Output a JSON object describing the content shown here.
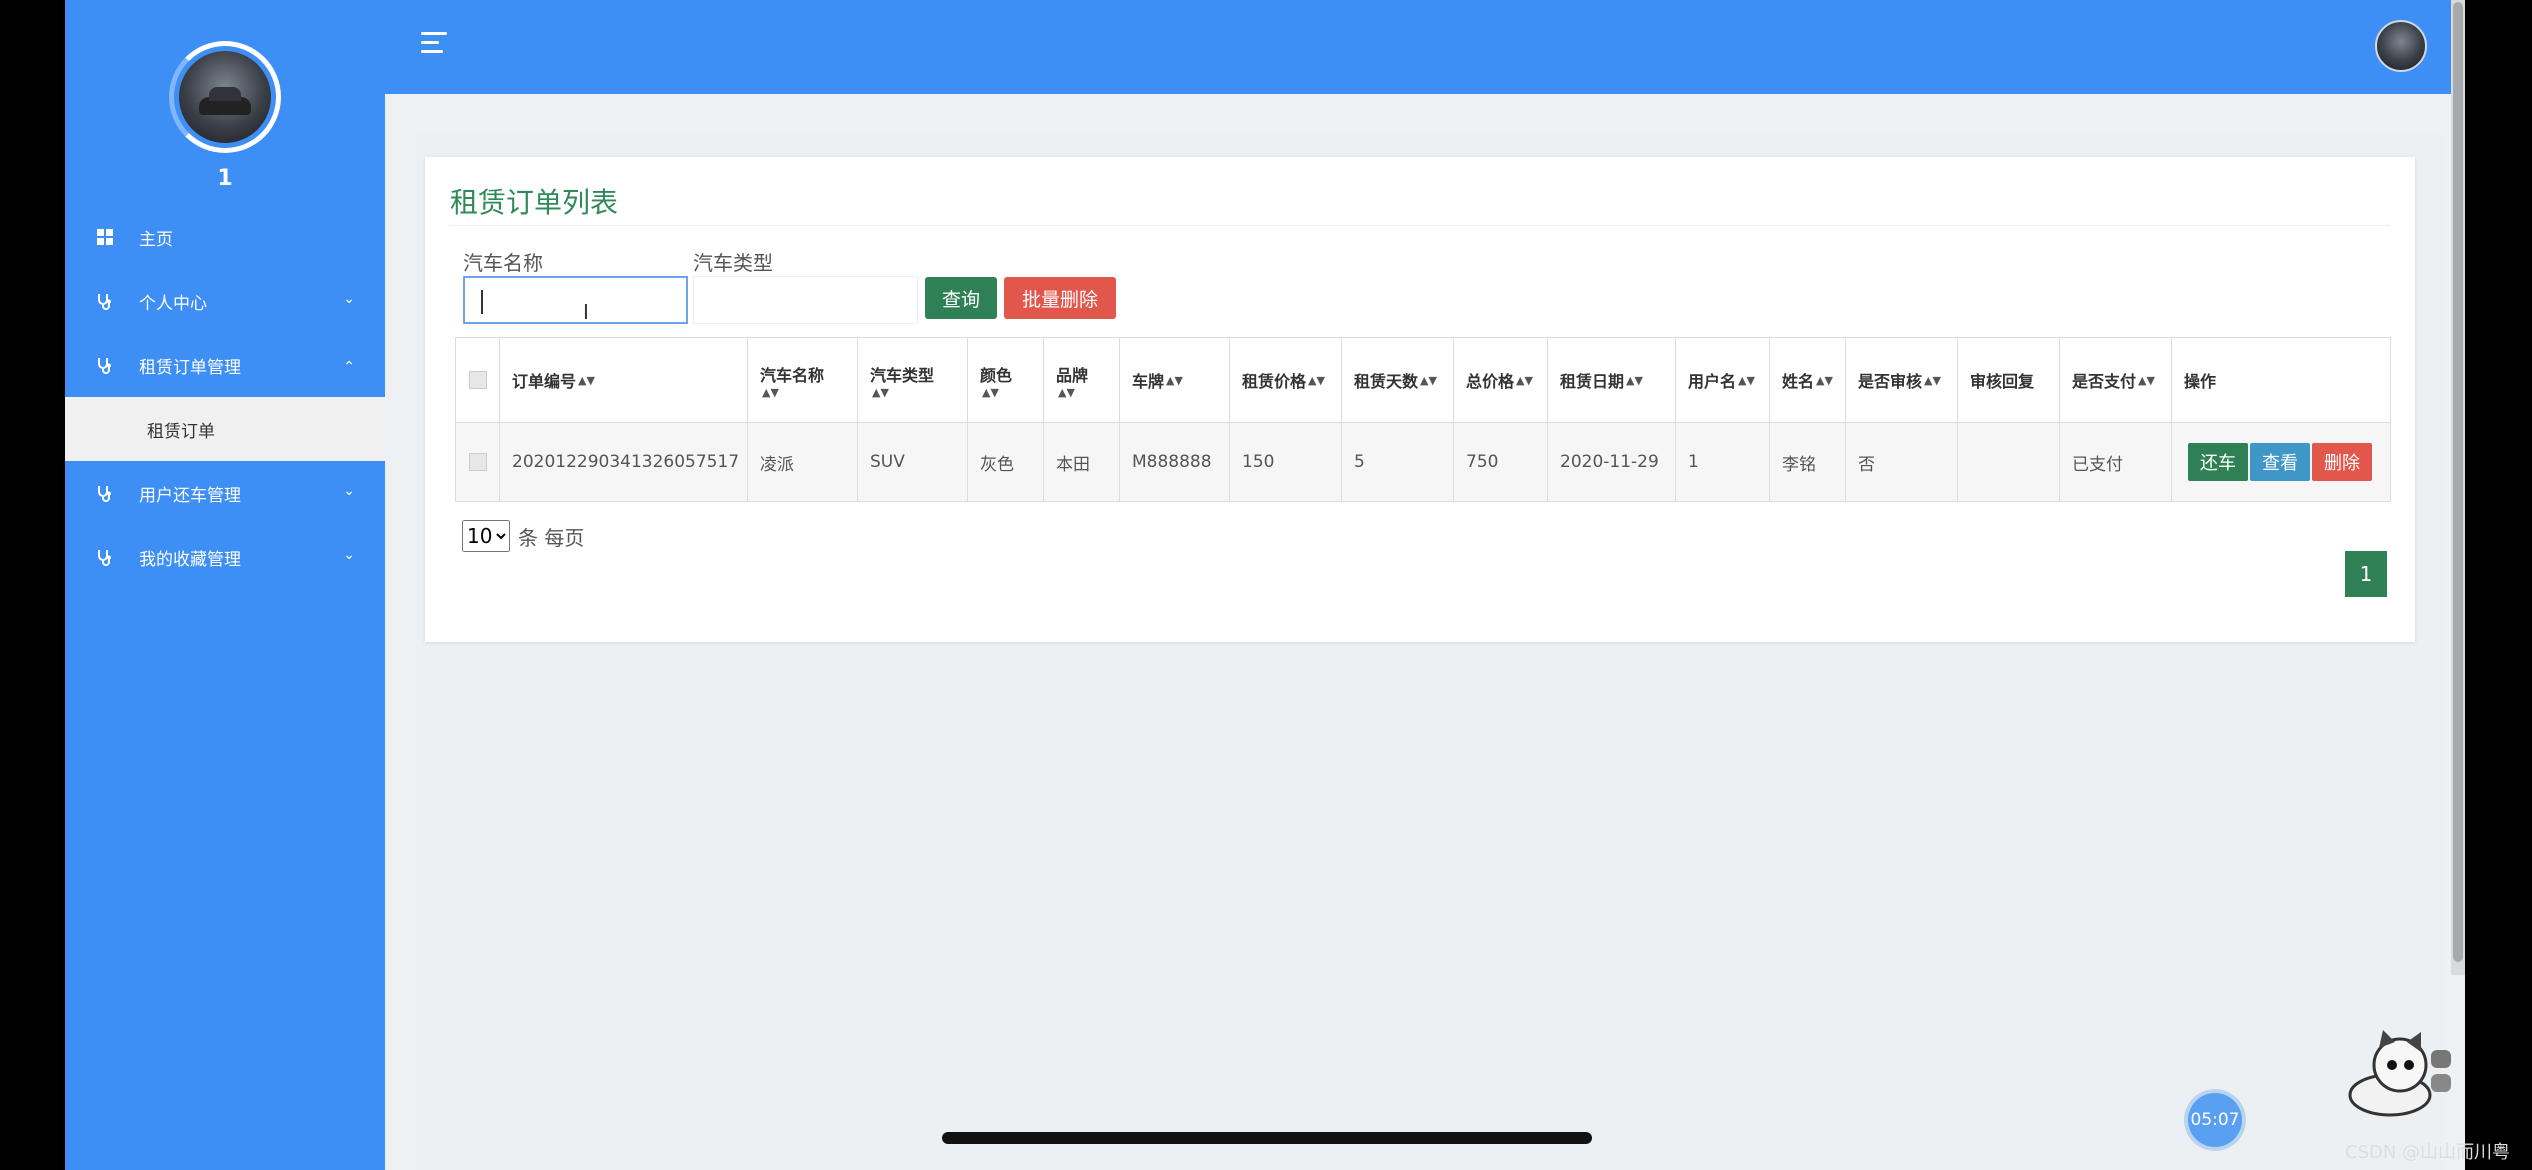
{
  "sidebar": {
    "username": "1",
    "items": [
      {
        "label": "主页",
        "icon": "dashboard-icon"
      },
      {
        "label": "个人中心",
        "icon": "stethoscope-icon",
        "chevron": "down"
      },
      {
        "label": "租赁订单管理",
        "icon": "stethoscope-icon",
        "chevron": "up"
      },
      {
        "label": "用户还车管理",
        "icon": "stethoscope-icon",
        "chevron": "down"
      },
      {
        "label": "我的收藏管理",
        "icon": "stethoscope-icon",
        "chevron": "down"
      }
    ],
    "sub_item": "租赁订单"
  },
  "panel": {
    "title": "租赁订单列表",
    "filters": {
      "car_name_label": "汽车名称",
      "car_type_label": "汽车类型",
      "car_name_value": "",
      "car_type_value": ""
    },
    "buttons": {
      "query": "查询",
      "batch_delete": "批量删除"
    }
  },
  "table": {
    "headers": [
      "订单编号",
      "汽车名称",
      "汽车类型",
      "颜色",
      "品牌",
      "车牌",
      "租赁价格",
      "租赁天数",
      "总价格",
      "租赁日期",
      "用户名",
      "姓名",
      "是否审核",
      "审核回复",
      "是否支付",
      "操作"
    ],
    "rows": [
      [
        "202012290341326057517",
        "凌派",
        "SUV",
        "灰色",
        "本田",
        "M888888",
        "150",
        "5",
        "750",
        "2020-11-29",
        "1",
        "李铭",
        "否",
        "",
        "已支付"
      ]
    ],
    "actions": {
      "return": "还车",
      "view": "查看",
      "delete": "删除"
    }
  },
  "pagination": {
    "page_size": "10",
    "per_page_text": "条 每页",
    "current_page": "1"
  },
  "overlay": {
    "timer": "05:07",
    "watermark": "CSDN @山山而川粤"
  },
  "colors": {
    "sidebar": "#3e8ff5",
    "accent_green": "#2f8055",
    "danger": "#e2574c",
    "info": "#3f97c8"
  }
}
